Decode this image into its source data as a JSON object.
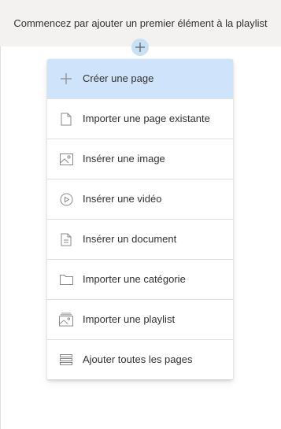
{
  "banner": {
    "text": "Commencez par ajouter un premier élément à la playlist"
  },
  "add_button": {
    "icon": "plus-icon"
  },
  "colors": {
    "banner_bg": "#f3f2f1",
    "highlight_bg": "#cfe4fa",
    "add_button_bg": "#c7e0f4",
    "icon_gray": "#8a8886",
    "text": "#323130"
  },
  "menu": {
    "items": [
      {
        "label": "Créer une page",
        "icon": "plus-icon",
        "highlighted": true
      },
      {
        "label": "Importer une page existante",
        "icon": "page-icon",
        "highlighted": false
      },
      {
        "label": "Insérer une image",
        "icon": "image-icon",
        "highlighted": false
      },
      {
        "label": "Insérer une vidéo",
        "icon": "video-play-icon",
        "highlighted": false
      },
      {
        "label": "Insérer un document",
        "icon": "document-icon",
        "highlighted": false
      },
      {
        "label": "Importer une catégorie",
        "icon": "folder-icon",
        "highlighted": false
      },
      {
        "label": "Importer une playlist",
        "icon": "playlist-icon",
        "highlighted": false
      },
      {
        "label": "Ajouter toutes les pages",
        "icon": "list-icon",
        "highlighted": false
      }
    ]
  }
}
